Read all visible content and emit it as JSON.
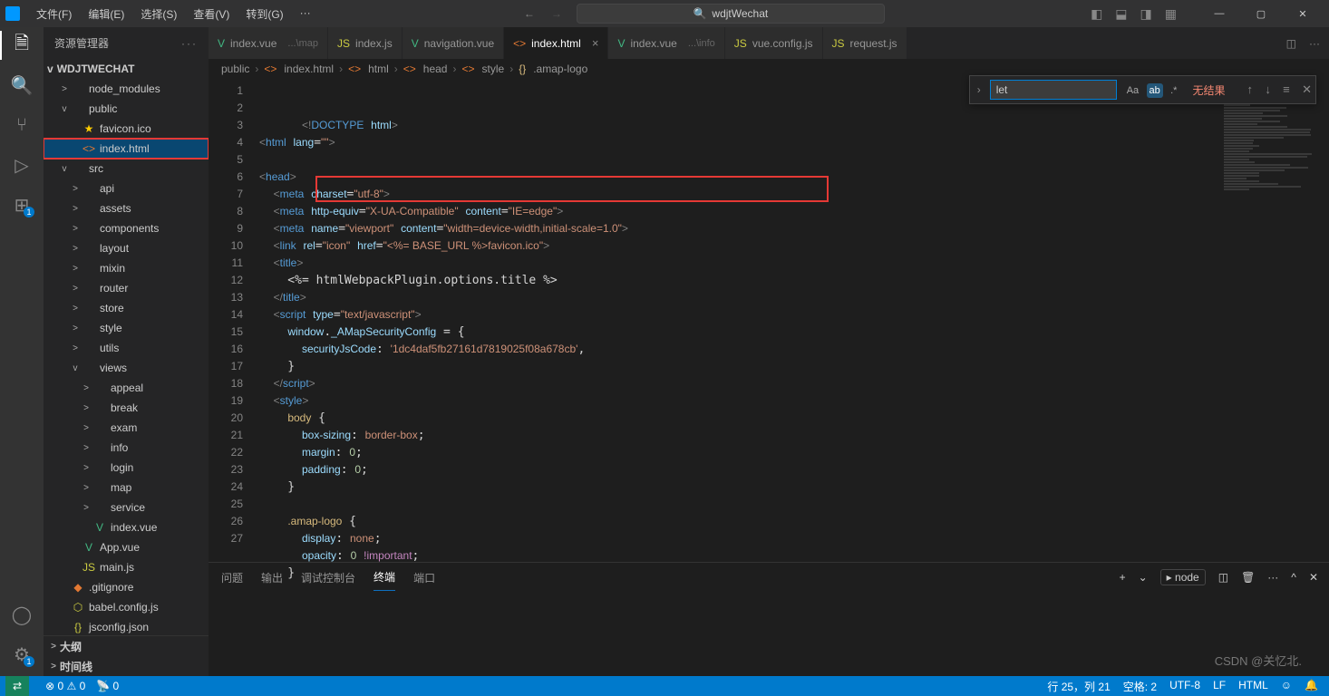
{
  "titlebar": {
    "project": "wdjtWechat",
    "menu": [
      "文件(F)",
      "编辑(E)",
      "选择(S)",
      "查看(V)",
      "转到(G)",
      "···"
    ]
  },
  "sidebar": {
    "title": "资源管理器",
    "project": "WDJTWECHAT",
    "tree": [
      {
        "d": 1,
        "tw": ">",
        "ic": "",
        "cls": "",
        "label": "node_modules"
      },
      {
        "d": 1,
        "tw": "v",
        "ic": "",
        "cls": "",
        "label": "public"
      },
      {
        "d": 2,
        "tw": "",
        "ic": "★",
        "cls": "star",
        "label": "favicon.ico"
      },
      {
        "d": 2,
        "tw": "",
        "ic": "<>",
        "cls": "html",
        "label": "index.html",
        "sel": true
      },
      {
        "d": 1,
        "tw": "v",
        "ic": "",
        "cls": "",
        "label": "src"
      },
      {
        "d": 2,
        "tw": ">",
        "ic": "",
        "cls": "",
        "label": "api"
      },
      {
        "d": 2,
        "tw": ">",
        "ic": "",
        "cls": "",
        "label": "assets"
      },
      {
        "d": 2,
        "tw": ">",
        "ic": "",
        "cls": "",
        "label": "components"
      },
      {
        "d": 2,
        "tw": ">",
        "ic": "",
        "cls": "",
        "label": "layout"
      },
      {
        "d": 2,
        "tw": ">",
        "ic": "",
        "cls": "",
        "label": "mixin"
      },
      {
        "d": 2,
        "tw": ">",
        "ic": "",
        "cls": "",
        "label": "router"
      },
      {
        "d": 2,
        "tw": ">",
        "ic": "",
        "cls": "",
        "label": "store"
      },
      {
        "d": 2,
        "tw": ">",
        "ic": "",
        "cls": "",
        "label": "style"
      },
      {
        "d": 2,
        "tw": ">",
        "ic": "",
        "cls": "",
        "label": "utils"
      },
      {
        "d": 2,
        "tw": "v",
        "ic": "",
        "cls": "",
        "label": "views"
      },
      {
        "d": 3,
        "tw": ">",
        "ic": "",
        "cls": "",
        "label": "appeal"
      },
      {
        "d": 3,
        "tw": ">",
        "ic": "",
        "cls": "",
        "label": "break"
      },
      {
        "d": 3,
        "tw": ">",
        "ic": "",
        "cls": "",
        "label": "exam"
      },
      {
        "d": 3,
        "tw": ">",
        "ic": "",
        "cls": "",
        "label": "info"
      },
      {
        "d": 3,
        "tw": ">",
        "ic": "",
        "cls": "",
        "label": "login"
      },
      {
        "d": 3,
        "tw": ">",
        "ic": "",
        "cls": "",
        "label": "map"
      },
      {
        "d": 3,
        "tw": ">",
        "ic": "",
        "cls": "",
        "label": "service"
      },
      {
        "d": 3,
        "tw": "",
        "ic": "V",
        "cls": "vue",
        "label": "index.vue"
      },
      {
        "d": 2,
        "tw": "",
        "ic": "V",
        "cls": "vue",
        "label": "App.vue"
      },
      {
        "d": 2,
        "tw": "",
        "ic": "JS",
        "cls": "js",
        "label": "main.js"
      },
      {
        "d": 1,
        "tw": "",
        "ic": "◆",
        "cls": "git",
        "label": ".gitignore"
      },
      {
        "d": 1,
        "tw": "",
        "ic": "⬡",
        "cls": "js",
        "label": "babel.config.js"
      },
      {
        "d": 1,
        "tw": "",
        "ic": "{}",
        "cls": "json",
        "label": "jsconfig.json"
      }
    ],
    "outline": "大纲",
    "timeline": "时间线"
  },
  "tabs": [
    {
      "ic": "V",
      "cls": "vue",
      "label": "index.vue",
      "dim": "...\\map"
    },
    {
      "ic": "JS",
      "cls": "js",
      "label": "index.js"
    },
    {
      "ic": "V",
      "cls": "vue",
      "label": "navigation.vue"
    },
    {
      "ic": "<>",
      "cls": "html",
      "label": "index.html",
      "active": true,
      "close": true
    },
    {
      "ic": "V",
      "cls": "vue",
      "label": "index.vue",
      "dim": "...\\info"
    },
    {
      "ic": "JS",
      "cls": "js",
      "label": "vue.config.js"
    },
    {
      "ic": "JS",
      "cls": "js",
      "label": "request.js"
    }
  ],
  "breadcrumb": [
    "public",
    "index.html",
    "html",
    "head",
    "style",
    ".amap-logo"
  ],
  "find": {
    "value": "let",
    "noresult": "无结果"
  },
  "code": {
    "lines": [
      "<span class='t-gray'>&lt;!</span><span class='t-blue'>DOCTYPE</span> <span class='t-attr'>html</span><span class='t-gray'>&gt;</span>",
      "<span class='t-gray'>&lt;</span><span class='t-blue'>html</span> <span class='t-attr'>lang</span>=<span class='t-str'>\"\"</span><span class='t-gray'>&gt;</span>",
      "",
      "<span class='t-gray'>&lt;</span><span class='t-blue'>head</span><span class='t-gray'>&gt;</span>",
      "  <span class='t-gray'>&lt;</span><span class='t-blue'>meta</span> <span class='t-attr'>charset</span>=<span class='t-str'>\"utf-8\"</span><span class='t-gray'>&gt;</span>",
      "  <span class='t-gray'>&lt;</span><span class='t-blue'>meta</span> <span class='t-attr'>http-equiv</span>=<span class='t-str'>\"X-UA-Compatible\"</span> <span class='t-attr'>content</span>=<span class='t-str'>\"IE=edge\"</span><span class='t-gray'>&gt;</span>",
      "  <span class='t-gray'>&lt;</span><span class='t-blue'>meta</span> <span class='t-attr'>name</span>=<span class='t-str'>\"viewport\"</span> <span class='t-attr'>content</span>=<span class='t-str'>\"width=device-width,initial-scale=1.0\"</span><span class='t-gray'>&gt;</span>",
      "  <span class='t-gray'>&lt;</span><span class='t-blue'>link</span> <span class='t-attr'>rel</span>=<span class='t-str'>\"icon\"</span> <span class='t-attr'>href</span>=<span class='t-str'>\"&lt;%= BASE_URL %&gt;favicon.ico\"</span><span class='t-gray'>&gt;</span>",
      "  <span class='t-gray'>&lt;</span><span class='t-blue'>title</span><span class='t-gray'>&gt;</span>",
      "    &lt;%= htmlWebpackPlugin.options.title %&gt;",
      "  <span class='t-gray'>&lt;/</span><span class='t-blue'>title</span><span class='t-gray'>&gt;</span>",
      "  <span class='t-gray'>&lt;</span><span class='t-blue'>script</span> <span class='t-attr'>type</span>=<span class='t-str'>\"text/javascript\"</span><span class='t-gray'>&gt;</span>",
      "    <span class='t-attr'>window</span>.<span class='t-attr'>_AMapSecurityConfig</span> = {",
      "      <span class='t-attr'>securityJsCode</span>: <span class='t-str'>'1dc4daf5fb27161d7819025f08a678cb'</span>,",
      "    }",
      "  <span class='t-gray'>&lt;/</span><span class='t-blue'>script</span><span class='t-gray'>&gt;</span>",
      "  <span class='t-gray'>&lt;</span><span class='t-blue'>style</span><span class='t-gray'>&gt;</span>",
      "    <span class='t-lbl'>body</span> {",
      "      <span class='t-attr'>box-sizing</span>: <span class='t-str'>border-box</span>;",
      "      <span class='t-attr'>margin</span>: <span class='t-num'>0</span>;",
      "      <span class='t-attr'>padding</span>: <span class='t-num'>0</span>;",
      "    }",
      "",
      "    <span class='t-lbl'>.amap-logo</span> {",
      "      <span class='t-attr'>display</span>: <span class='t-str'>none</span>;",
      "      <span class='t-attr'>opacity</span>: <span class='t-num'>0</span> <span class='t-kw'>!important</span>;",
      "    }"
    ]
  },
  "panel": {
    "tabs": [
      "问题",
      "输出",
      "调试控制台",
      "终端",
      "端口"
    ],
    "active": 3,
    "node": "node"
  },
  "status": {
    "errors": "0",
    "warnings": "0",
    "port": "0",
    "ln": "行 25，列 21",
    "spaces": "空格: 2",
    "enc": "UTF-8",
    "eol": "LF",
    "lang": "HTML"
  },
  "watermark": "CSDN @关忆北."
}
